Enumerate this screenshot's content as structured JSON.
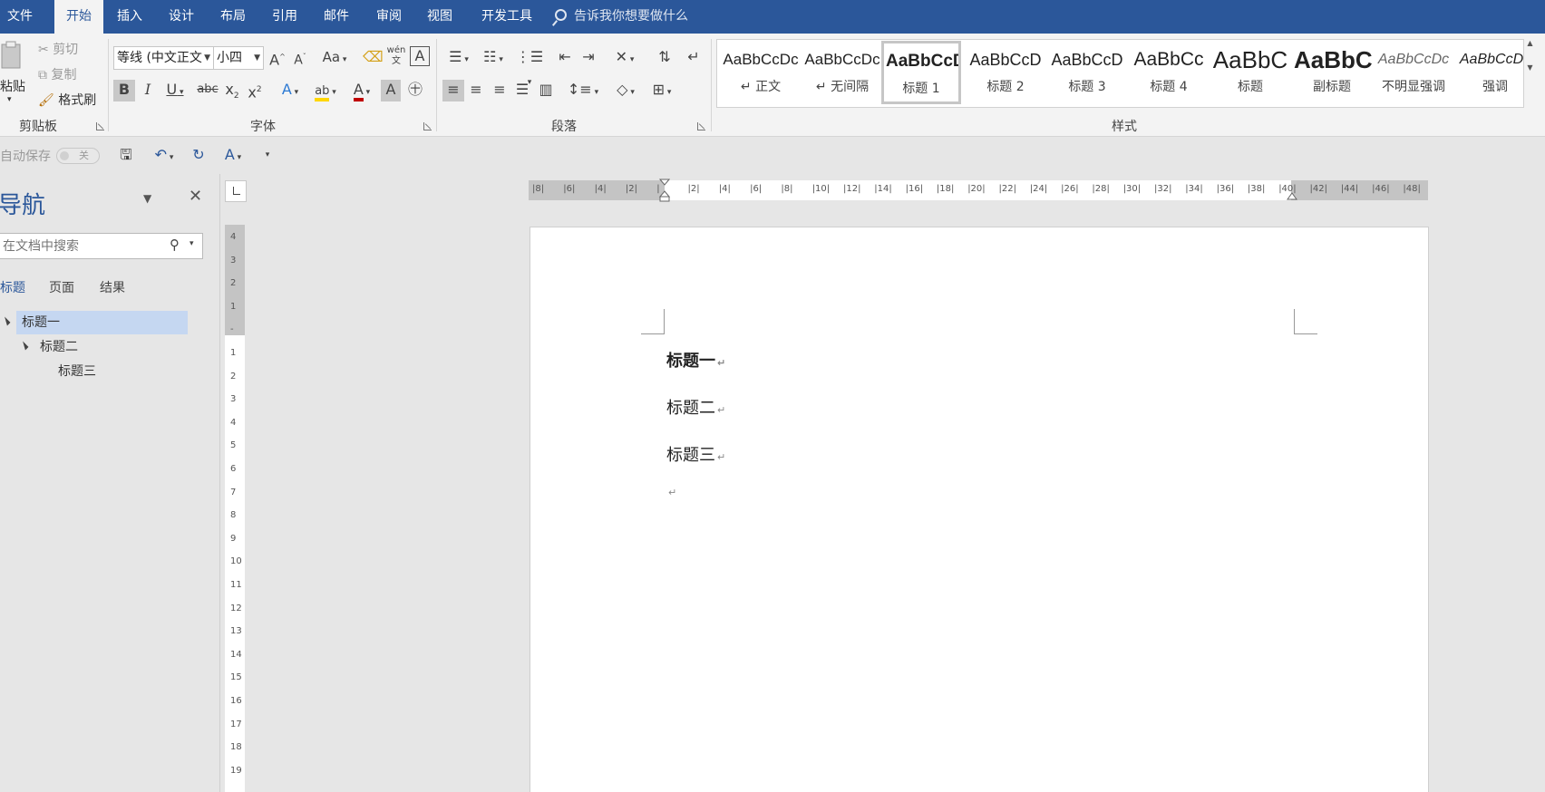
{
  "tabs": [
    "文件",
    "开始",
    "插入",
    "设计",
    "布局",
    "引用",
    "邮件",
    "审阅",
    "视图",
    "开发工具"
  ],
  "active_tab": "开始",
  "tell_me": "告诉我你想要做什么",
  "clipboard": {
    "paste": "粘贴",
    "cut": "剪切",
    "copy": "复制",
    "format_painter": "格式刷",
    "group": "剪贴板"
  },
  "font": {
    "name": "等线 (中文正文",
    "size": "小四",
    "change_case": "Aa",
    "phonetic": "wén",
    "group": "字体"
  },
  "paragraph": {
    "group": "段落"
  },
  "styles": {
    "group": "样式",
    "items": [
      {
        "preview": "AaBbCcDc",
        "name": "正文"
      },
      {
        "preview": "AaBbCcDc",
        "name": "无间隔"
      },
      {
        "preview": "AaBbCcD",
        "name": "标题 1"
      },
      {
        "preview": "AaBbCcD",
        "name": "标题 2"
      },
      {
        "preview": "AaBbCcD",
        "name": "标题 3"
      },
      {
        "preview": "AaBbCc",
        "name": "标题 4"
      },
      {
        "preview": "AaBbC",
        "name": "标题"
      },
      {
        "preview": "AaBbC",
        "name": "副标题"
      },
      {
        "preview": "AaBbCcDc",
        "name": "不明显强调"
      },
      {
        "preview": "AaBbCcDc",
        "name": "强调"
      }
    ]
  },
  "qat": {
    "autosave": "自动保存",
    "autosave_state": "关"
  },
  "nav": {
    "title": "导航",
    "search_placeholder": "在文档中搜索",
    "tabs": [
      "标题",
      "页面",
      "结果"
    ],
    "tree": [
      "标题一",
      "标题二",
      "标题三"
    ]
  },
  "ruler": {
    "h_labels": [
      "8",
      "6",
      "4",
      "2",
      "",
      "2",
      "4",
      "6",
      "8",
      "10",
      "12",
      "14",
      "16",
      "18",
      "20",
      "22",
      "24",
      "26",
      "28",
      "30",
      "32",
      "34",
      "36",
      "38",
      "40",
      "42",
      "44",
      "46",
      "48"
    ],
    "v_labels": [
      "4",
      "3",
      "2",
      "1",
      "",
      "1",
      "2",
      "3",
      "4",
      "5",
      "6",
      "7",
      "8",
      "9",
      "10",
      "11",
      "12",
      "13",
      "14",
      "15",
      "16",
      "17",
      "18",
      "19"
    ]
  },
  "document": {
    "paragraphs": [
      "标题一",
      "标题二",
      "标题三",
      ""
    ],
    "para_mark": "↵"
  },
  "colors": {
    "accent": "#2b579a",
    "nav_selected": "#c5d7f1",
    "font_color": "#c00000",
    "highlight": "#ffd700"
  }
}
